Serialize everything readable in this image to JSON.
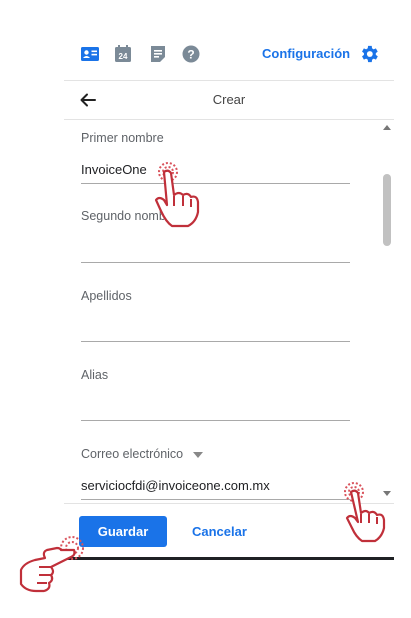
{
  "toolbar": {
    "icons": [
      "contact-card-icon",
      "calendar-icon",
      "notes-icon",
      "help-icon"
    ],
    "calendar_day": "24",
    "settings_label": "Configuración",
    "settings_icon": "gear-icon"
  },
  "header": {
    "back_icon": "arrow-left-icon",
    "title": "Crear"
  },
  "form": {
    "first_name": {
      "label": "Primer nombre",
      "value": "InvoiceOne"
    },
    "middle_name": {
      "label": "Segundo nombre",
      "value": ""
    },
    "last_name": {
      "label": "Apellidos",
      "value": ""
    },
    "nickname": {
      "label": "Alias",
      "value": ""
    },
    "email": {
      "label": "Correo electrónico",
      "value": "serviciocfdi@invoiceone.com.mx"
    }
  },
  "actions": {
    "save_label": "Guardar",
    "cancel_label": "Cancelar"
  },
  "colors": {
    "accent": "#1a73e8",
    "hand_outline": "#c0303a"
  }
}
